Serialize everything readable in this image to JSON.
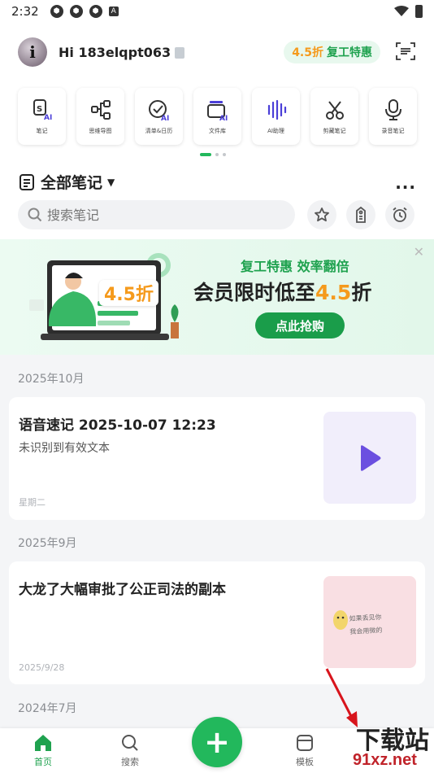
{
  "status_bar": {
    "time": "2:32",
    "icons": [
      "app-icon",
      "app-icon",
      "app-icon",
      "a-icon"
    ],
    "wifi": "wifi-icon",
    "battery": "battery-icon"
  },
  "header": {
    "greeting": "Hi 183elqpt063",
    "promo_discount": "4.5折",
    "promo_label": "复工特惠"
  },
  "tools": [
    {
      "label": "笔记",
      "icon": "ai-note-icon"
    },
    {
      "label": "思维导图",
      "icon": "mindmap-icon"
    },
    {
      "label": "清单&日历",
      "icon": "todo-calendar-icon"
    },
    {
      "label": "文件库",
      "icon": "file-library-icon"
    },
    {
      "label": "AI助理",
      "icon": "ai-assistant-icon"
    },
    {
      "label": "剪藏笔记",
      "icon": "clip-icon"
    },
    {
      "label": "录音笔记",
      "icon": "microphone-icon"
    }
  ],
  "notes_header": {
    "title": "全部笔记",
    "search_placeholder": "搜索笔记"
  },
  "banner": {
    "tagline": "复工特惠 效率翻倍",
    "headline_prefix": "会员限时低至",
    "headline_discount": "4.5",
    "headline_suffix": "折",
    "art_discount": "4.5折",
    "cta": "点此抢购"
  },
  "sections": [
    {
      "date": "2025年10月",
      "note": {
        "title": "语音速记 2025-10-07 12:23",
        "subtitle": "未识别到有效文本",
        "meta": "星期二"
      }
    },
    {
      "date": "2025年9月",
      "note": {
        "title": "大龙了大幅审批了公正司法的副本",
        "meta": "2025/9/28",
        "thumb_line1": "如果丢见你",
        "thumb_line2": "我会用微的"
      }
    },
    {
      "date": "2024年7月"
    }
  ],
  "bottom_nav": {
    "home": "首页",
    "search": "搜索",
    "templates": "模板"
  },
  "watermark": {
    "main": "下载站",
    "sub": "91xz.net"
  },
  "colors": {
    "brand_green": "#22b85c",
    "promo_orange": "#f59a1c"
  }
}
